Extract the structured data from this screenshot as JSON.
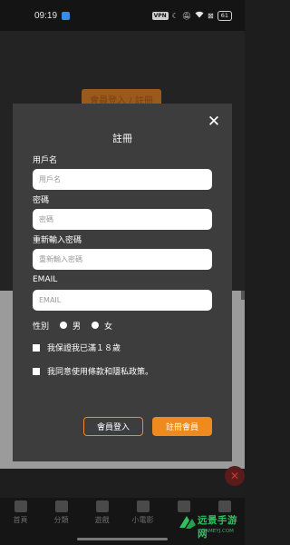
{
  "status_bar": {
    "time": "09:19",
    "vpn": "VPN",
    "battery": "61"
  },
  "background": {
    "login_button": "會員登入 / 註冊",
    "close_glyph": "✕"
  },
  "modal": {
    "close_glyph": "✕",
    "title": "註冊",
    "fields": [
      {
        "label": "用戶名",
        "placeholder": "用戶名"
      },
      {
        "label": "密碼",
        "placeholder": "密碼"
      },
      {
        "label": "重新輸入密碼",
        "placeholder": "重新輸入密碼"
      },
      {
        "label": "EMAIL",
        "placeholder": "EMAIL"
      }
    ],
    "gender": {
      "label": "性別",
      "options": [
        "男",
        "女"
      ]
    },
    "checks": [
      "我保證我已滿１８歲",
      "我同意使用條款和隱私政策。"
    ],
    "login_button": "會員登入",
    "register_button": "註冊會員",
    "accent": "#ef8b1e"
  },
  "tabs": [
    {
      "label": "首頁",
      "icon": "home-icon"
    },
    {
      "label": "分類",
      "icon": "layers-icon"
    },
    {
      "label": "遊戲",
      "icon": "gamepad-icon"
    },
    {
      "label": "小電影",
      "icon": "video-icon"
    },
    {
      "label": "",
      "icon": "chat-icon"
    },
    {
      "label": "",
      "icon": "user-icon"
    }
  ],
  "watermark": {
    "title": "远景手游网",
    "subtitle": "GAMEYJ.COM"
  }
}
